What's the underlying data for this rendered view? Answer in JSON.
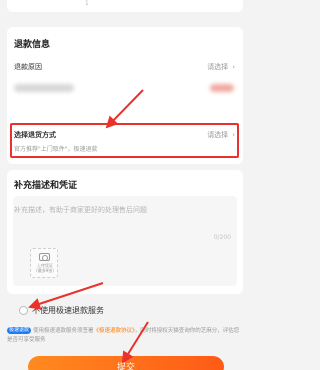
{
  "top": {
    "faint_text": "1"
  },
  "refund_info": {
    "title": "退款信息",
    "reason_label": "退款原因",
    "reason_value": "请选择",
    "method_label": "选择退货方式",
    "method_value": "请选择",
    "method_hint": "官方推荐\"上门取件\"，极速退款"
  },
  "evidence": {
    "title": "补充描述和凭证",
    "placeholder": "补充描述，有助于商家更好的处理售后问题",
    "counter": "0/200",
    "upload_line1": "上传凭证",
    "upload_line2": "(最多9张)"
  },
  "no_fast_refund": {
    "label": "不使用极速退款服务"
  },
  "notice": {
    "badge": "极速退款",
    "text_before": "使用极速退款服务须签署",
    "agreement": "《极速退款协议》",
    "text_after": "，同时将授权天猫查询你的芝麻分，评估您是否可享受服务"
  },
  "submit": {
    "label": "提交"
  },
  "colors": {
    "accent": "#ff5a16",
    "annotation_red": "#e8322b",
    "badge_blue": "#1f7cf5"
  }
}
